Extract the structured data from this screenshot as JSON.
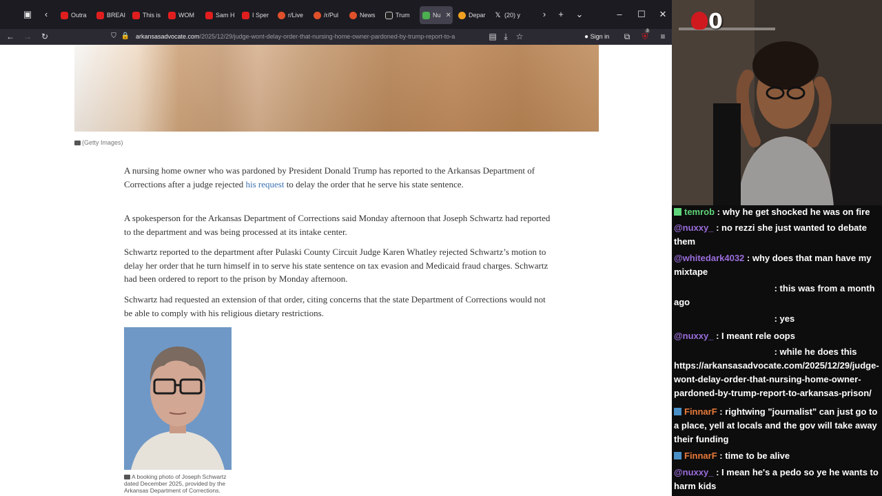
{
  "browser": {
    "tabs": [
      {
        "label": "Outra",
        "favicon": "youtube-icon"
      },
      {
        "label": "BREAI",
        "favicon": "youtube-icon"
      },
      {
        "label": "This is",
        "favicon": "youtube-icon"
      },
      {
        "label": "WOM",
        "favicon": "youtube-icon"
      },
      {
        "label": "Sam H",
        "favicon": "youtube-icon"
      },
      {
        "label": "I Sper",
        "favicon": "youtube-icon"
      },
      {
        "label": "r/Live",
        "favicon": "reddit-icon"
      },
      {
        "label": "/r/Pul",
        "favicon": "reddit-icon"
      },
      {
        "label": "News",
        "favicon": "reddit-icon"
      },
      {
        "label": "Trum",
        "favicon": "ap-icon"
      },
      {
        "label": "Nu",
        "favicon": "arkansas-advocate-icon",
        "active": true
      },
      {
        "label": "Depar",
        "favicon": "generic-icon"
      },
      {
        "label": "(20) y",
        "favicon": "x-icon"
      }
    ],
    "url_domain": "arkansasadvocate.com",
    "url_path": "/2025/12/29/judge-wont-delay-order-that-nursing-home-owner-pardoned-by-trump-report-to-a",
    "sign_in": "Sign in",
    "extension_badge": "3"
  },
  "article": {
    "hero_credit": "(Getty Images)",
    "p1_before": "A nursing home owner who was pardoned by President Donald Trump has reported to the Arkansas Department of Corrections after a judge rejected ",
    "p1_link": "his request",
    "p1_after": " to delay the order that he serve his state sentence.",
    "p2": "A spokesperson for the Arkansas Department of Corrections said Monday afternoon that Joseph Schwartz had reported to the department and was being processed at its intake center.",
    "p3": "Schwartz reported to the department after Pulaski County Circuit Judge Karen Whatley rejected Schwartz’s motion to delay her order that he turn himself in to serve his state sentence on tax evasion and Medicaid fraud charges. Schwartz had been ordered to report to the prison by Monday afternoon.",
    "p4": "Schwartz had requested an extension of that order, citing concerns that the state Department of Corrections would not be able to comply with his religious dietary restrictions.",
    "photo_caption": "A booking photo of Joseph Schwartz dated December 2025, provided by the Arkansas Department of Corrections."
  },
  "overlay": {
    "counter": "0"
  },
  "chat": {
    "messages": [
      {
        "user": "temrob",
        "text": " : why he get shocked he was on fire",
        "color": "#5fd47a"
      },
      {
        "user": "@nuxxy_",
        "text": " : no rezzi she just wanted to debate them",
        "color": "#9b6ddc"
      },
      {
        "user": "@whitedark4032",
        "text": " : why does that man have my mixtape",
        "color": "#9b6ddc"
      },
      {
        "user": "",
        "text": " : this was from a month ago",
        "color": "#ffffff"
      },
      {
        "user": "",
        "text": " : yes",
        "color": "#ffffff"
      },
      {
        "user": "@nuxxy_",
        "text": " : I meant rele oops",
        "color": "#9b6ddc"
      },
      {
        "user": "",
        "text": " : while he does this https://arkansasadvocate.com/2025/12/29/judge-wont-delay-order-that-nursing-home-owner-pardoned-by-trump-report-to-arkansas-prison/",
        "color": "#ffffff"
      },
      {
        "user": "FinnarF",
        "text": " : rightwing \"journalist\" can just go to a place, yell at locals and the gov will take away their funding",
        "color": "#e87a3a"
      },
      {
        "user": "FinnarF",
        "text": " : time to be alive",
        "color": "#e87a3a"
      },
      {
        "user": "@nuxxy_",
        "text": " : I mean he's a pedo so ye he wants to harm kids",
        "color": "#9b6ddc"
      }
    ]
  }
}
